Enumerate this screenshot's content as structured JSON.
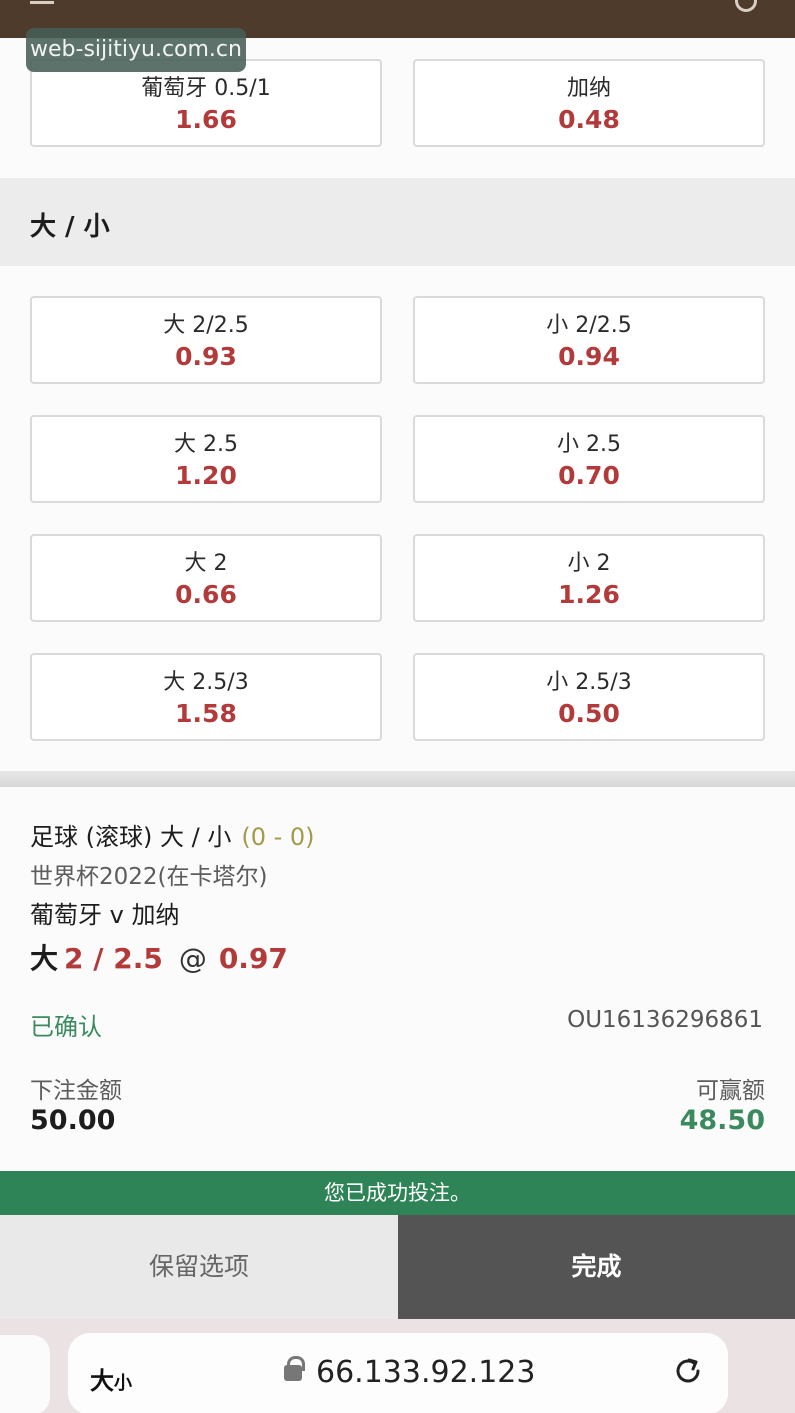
{
  "watermark": "web-sijitiyu.com.cn",
  "top_odds": [
    {
      "label": "葡萄牙 0.5/1",
      "price": "1.66"
    },
    {
      "label": "加纳",
      "price": "0.48"
    }
  ],
  "section": {
    "title": "大 / 小"
  },
  "over_under": [
    {
      "label": "大 2/2.5",
      "price": "0.93"
    },
    {
      "label": "小 2/2.5",
      "price": "0.94"
    },
    {
      "label": "大 2.5",
      "price": "1.20"
    },
    {
      "label": "小 2.5",
      "price": "0.70"
    },
    {
      "label": "大 2",
      "price": "0.66"
    },
    {
      "label": "小 2",
      "price": "1.26"
    },
    {
      "label": "大 2.5/3",
      "price": "1.58"
    },
    {
      "label": "小 2.5/3",
      "price": "0.50"
    }
  ],
  "bet_slip": {
    "market": "足球 (滚球) 大 / 小",
    "score": "(0 - 0)",
    "league": "世界杯2022(在卡塔尔)",
    "match": "葡萄牙 v 加纳",
    "selection_side": "大",
    "selection_line": "2 / 2.5",
    "at_symbol": "@",
    "selection_odds": "0.97",
    "status": "已确认",
    "reference": "OU16136296861",
    "stake_label": "下注金额",
    "stake_value": "50.00",
    "win_label": "可赢额",
    "win_value": "48.50"
  },
  "success_message": "您已成功投注。",
  "actions": {
    "keep": "保留选项",
    "done": "完成"
  },
  "browser": {
    "text_size_big": "大",
    "text_size_small": "小",
    "url": "66.133.92.123"
  },
  "colors": {
    "accent_green": "#2e8457",
    "odds_red": "#b23a3a",
    "header_brown": "#4e3b2c"
  }
}
